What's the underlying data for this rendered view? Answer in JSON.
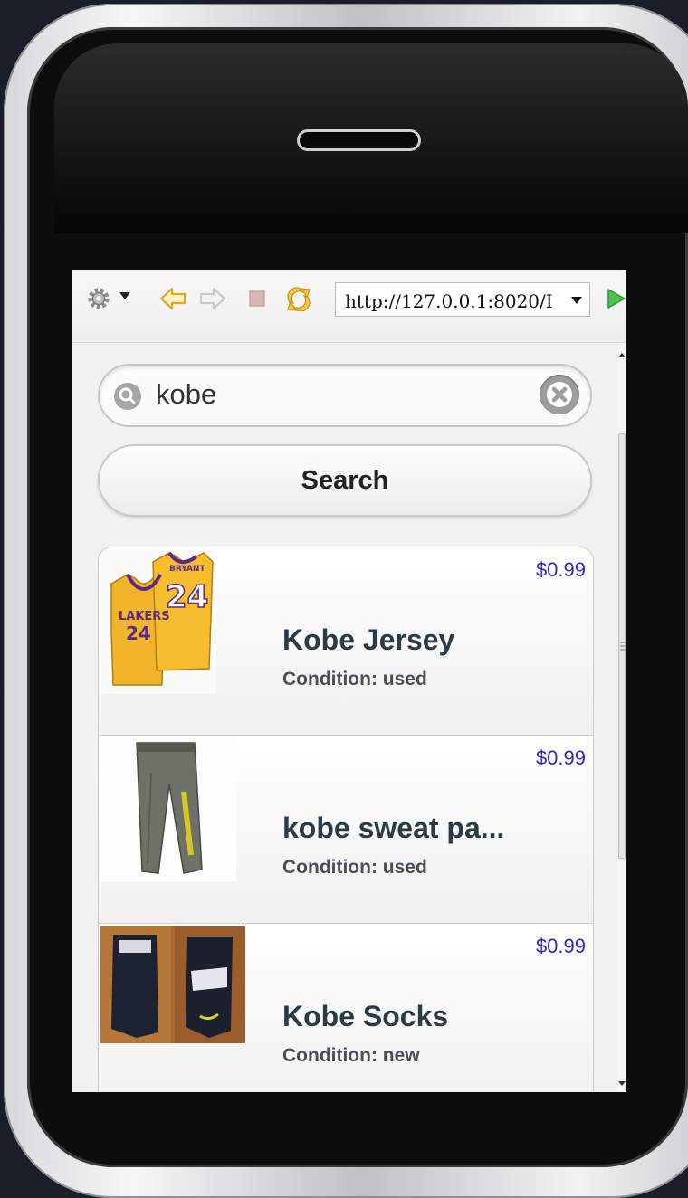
{
  "browser": {
    "url": "http://127.0.0.1:8020/I"
  },
  "search": {
    "value": "kobe",
    "button_label": "Search"
  },
  "results": [
    {
      "title": "Kobe Jersey",
      "condition": "Condition: used",
      "price": "$0.99",
      "thumbnail": "yellow-lakers-jersey-image"
    },
    {
      "title": "kobe sweat pa...",
      "condition": "Condition: used",
      "price": "$0.99",
      "thumbnail": "grey-sweat-pants-image"
    },
    {
      "title": "Kobe Socks",
      "condition": "Condition: new",
      "price": "$0.99",
      "thumbnail": "black-socks-image"
    }
  ],
  "colors": {
    "price": "#2b28c8",
    "title": "#2c3a44",
    "go_arrow": "#36b336",
    "nav_arrow": "#f2c23a"
  }
}
